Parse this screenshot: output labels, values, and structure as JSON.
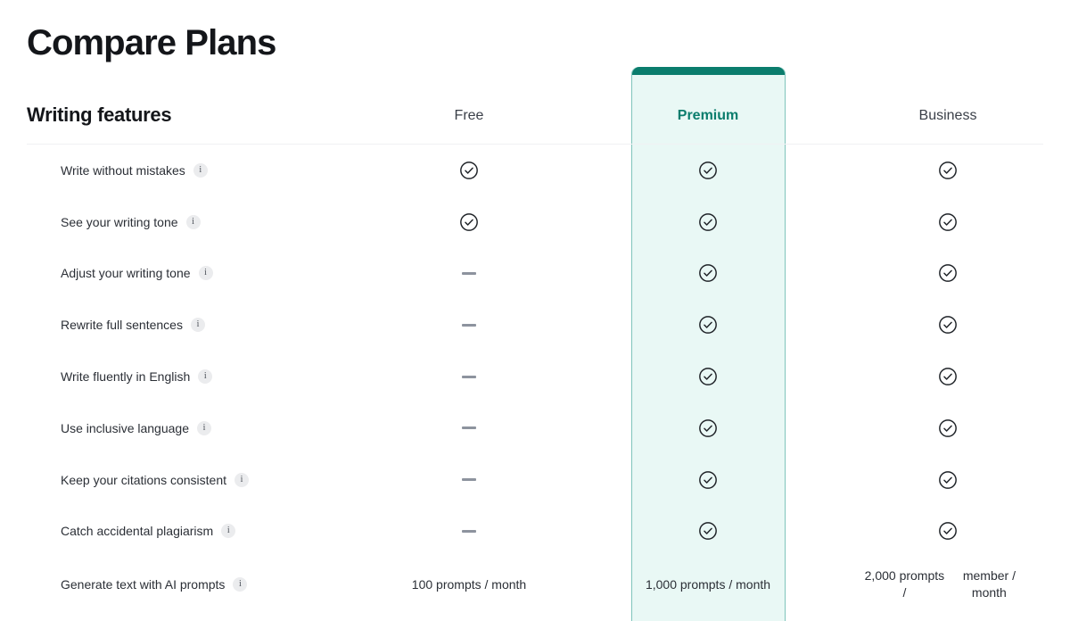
{
  "page": {
    "title": "Compare Plans"
  },
  "section": {
    "heading": "Writing features"
  },
  "plans": [
    {
      "key": "free",
      "label": "Free",
      "highlighted": false
    },
    {
      "key": "premium",
      "label": "Premium",
      "highlighted": true
    },
    {
      "key": "business",
      "label": "Business",
      "highlighted": false
    }
  ],
  "colors": {
    "accent_teal": "#0b7d6d",
    "premium_bg": "#e9f8f5",
    "premium_border": "#7fc4bb",
    "divider": "#f0f1f3",
    "dash": "#8d939e",
    "text_primary": "#14161a",
    "text_body": "#2b2f36"
  },
  "icons": {
    "info": "i",
    "check": "check-circle-icon",
    "dash": "dash-icon"
  },
  "features": [
    {
      "label": "Write without mistakes",
      "info": "i",
      "free": {
        "type": "check"
      },
      "premium": {
        "type": "check"
      },
      "business": {
        "type": "check"
      }
    },
    {
      "label": "See your writing tone",
      "info": "i",
      "free": {
        "type": "check"
      },
      "premium": {
        "type": "check"
      },
      "business": {
        "type": "check"
      }
    },
    {
      "label": "Adjust your writing tone",
      "info": "i",
      "free": {
        "type": "dash"
      },
      "premium": {
        "type": "check"
      },
      "business": {
        "type": "check"
      }
    },
    {
      "label": "Rewrite full sentences",
      "info": "i",
      "free": {
        "type": "dash"
      },
      "premium": {
        "type": "check"
      },
      "business": {
        "type": "check"
      }
    },
    {
      "label": "Write fluently in English",
      "info": "i",
      "free": {
        "type": "dash"
      },
      "premium": {
        "type": "check"
      },
      "business": {
        "type": "check"
      }
    },
    {
      "label": "Use inclusive language",
      "info": "i",
      "free": {
        "type": "dash"
      },
      "premium": {
        "type": "check"
      },
      "business": {
        "type": "check"
      }
    },
    {
      "label": "Keep your citations consistent",
      "info": "i",
      "free": {
        "type": "dash"
      },
      "premium": {
        "type": "check"
      },
      "business": {
        "type": "check"
      }
    },
    {
      "label": "Catch accidental plagiarism",
      "info": "i",
      "free": {
        "type": "dash"
      },
      "premium": {
        "type": "check"
      },
      "business": {
        "type": "check"
      }
    },
    {
      "label": "Generate text with AI prompts",
      "info": "i",
      "free": {
        "type": "text",
        "value": "100 prompts / month"
      },
      "premium": {
        "type": "text",
        "value": "1,000 prompts / month"
      },
      "business": {
        "type": "text",
        "value": "2,000 prompts /\nmember / month"
      }
    }
  ]
}
